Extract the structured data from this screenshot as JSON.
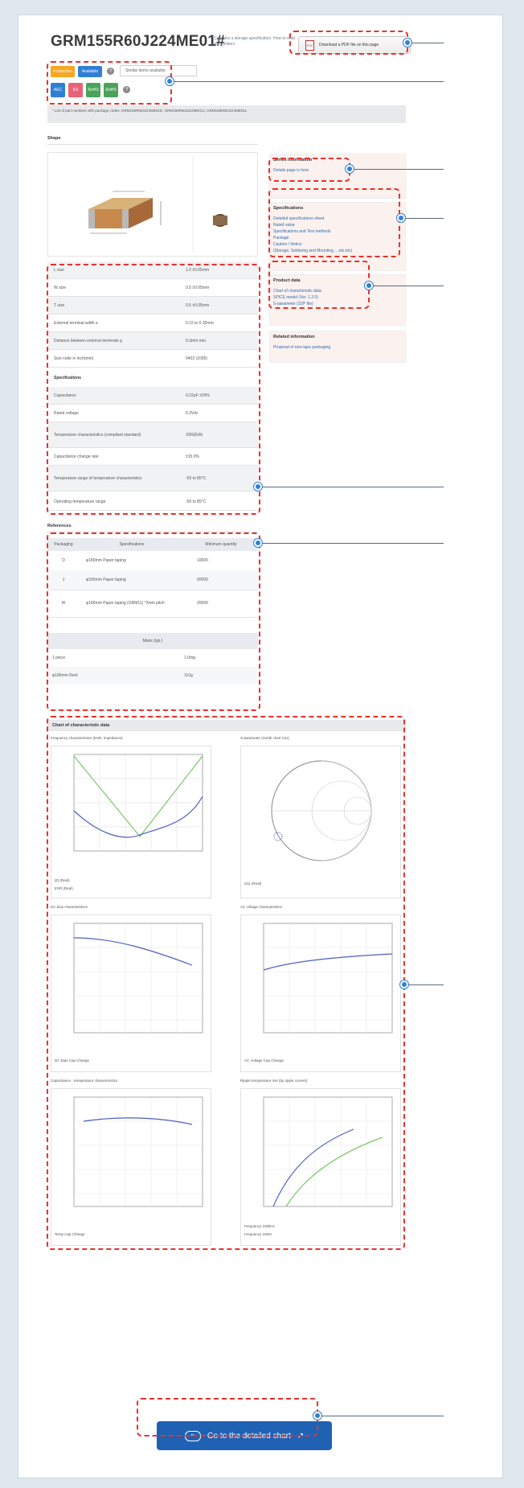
{
  "product": {
    "part_number": "GRM155R60J224ME01#",
    "note": "* Contains a storage specification. How to read part numbers"
  },
  "pdf_button": {
    "label": "Download a PDF file on this page",
    "icon": "pdf-icon"
  },
  "badges": {
    "status": "Production",
    "available": "Available",
    "similar_link": "Similar items available",
    "icons": [
      "AEC",
      "ES",
      "RoHS",
      "RoHS"
    ]
  },
  "sub_notice": "* List of part numbers with package codes: GRM155R60J224ME01D, GRM155R60J224ME01J, GRM155R60J224ME01L",
  "shape": {
    "heading": "Shape"
  },
  "series_info": {
    "heading": "Series information",
    "links": [
      "Details page is here"
    ]
  },
  "specs_panel": {
    "heading": "Specifications",
    "links": [
      "Detailed specifications sheet",
      "Rated value",
      "Specifications and Test methods",
      "Package",
      "Caution / Notice",
      "(Storage, Soldering and Mounting, ...etc.etc)"
    ]
  },
  "product_data": {
    "heading": "Product data",
    "links": [
      "Chart of characteristic data",
      "SPICE model (Ver. 1.2.0)",
      "S-parameter (S2P file)"
    ]
  },
  "related": {
    "heading": "Related information",
    "links": [
      "Proposal of new tape packaging"
    ]
  },
  "dim_rows": [
    {
      "k": "L size",
      "v": "1.0 ±0.05mm"
    },
    {
      "k": "W size",
      "v": "0.5 ±0.05mm"
    },
    {
      "k": "T size",
      "v": "0.5 ±0.05mm"
    },
    {
      "k": "External terminal width e",
      "v": "0.15 to 0.35mm"
    },
    {
      "k": "Distance between external terminals g",
      "v": "0.3mm min."
    },
    {
      "k": "Size code in inch(mm)",
      "v": "0402 (1005)"
    }
  ],
  "spec_heading": "Specifications",
  "spec_rows": [
    {
      "k": "Capacitance",
      "v": "0.22μF ±20%"
    },
    {
      "k": "Rated voltage",
      "v": "6.3Vdc"
    },
    {
      "k": "Temperature characteristics (compliant standard)",
      "v": "X5R(EIA)"
    },
    {
      "k": "Capacitance change rate",
      "v": "±15.0%"
    },
    {
      "k": "Temperature range of temperature characteristics",
      "v": "-55 to 85°C"
    },
    {
      "k": "Operating temperature range",
      "v": "-55 to 85°C"
    }
  ],
  "references": {
    "heading": "References",
    "cols": [
      "Packaging",
      "Specifications",
      "Minimum quantity"
    ],
    "rows": [
      {
        "p": "D",
        "s": "φ180mm Paper taping",
        "q": "10000"
      },
      {
        "p": "J",
        "s": "φ330mm Paper taping",
        "q": "50000"
      },
      {
        "p": "W",
        "s": "φ180mm Paper taping (GRM11) *2mm pitch",
        "q": "20000"
      }
    ],
    "mass_header": "Mass (typ.)",
    "mass_rows": [
      {
        "k": "1 piece",
        "v": "1.0mg"
      },
      {
        "k": "φ180mm Reel",
        "v": "110g"
      }
    ]
  },
  "charts": {
    "heading": "Chart of characteristic data",
    "titles": [
      "Frequency characteristics (ESR, Impedance)",
      "S-parameter (Smith chart S11)",
      "DC bias characteristics",
      "AC voltage characteristics",
      "Capacitance - temperature characteristics",
      "Ripple temperature rise (by ripple current)"
    ],
    "legends": [
      "|Z| (Real)",
      "ESR (Real)",
      "S11 (Real)",
      "DC Bias Cap Change",
      "AC Voltage Cap Change",
      "Temp Cap Change",
      "Frequency 100kHz",
      "Frequency 1MHz"
    ]
  },
  "cta": {
    "label": "Go to the detailed chart"
  },
  "colors": {
    "accent": "#1f62b3",
    "callout": "#e8312e",
    "dot": "#2f7fd6"
  }
}
